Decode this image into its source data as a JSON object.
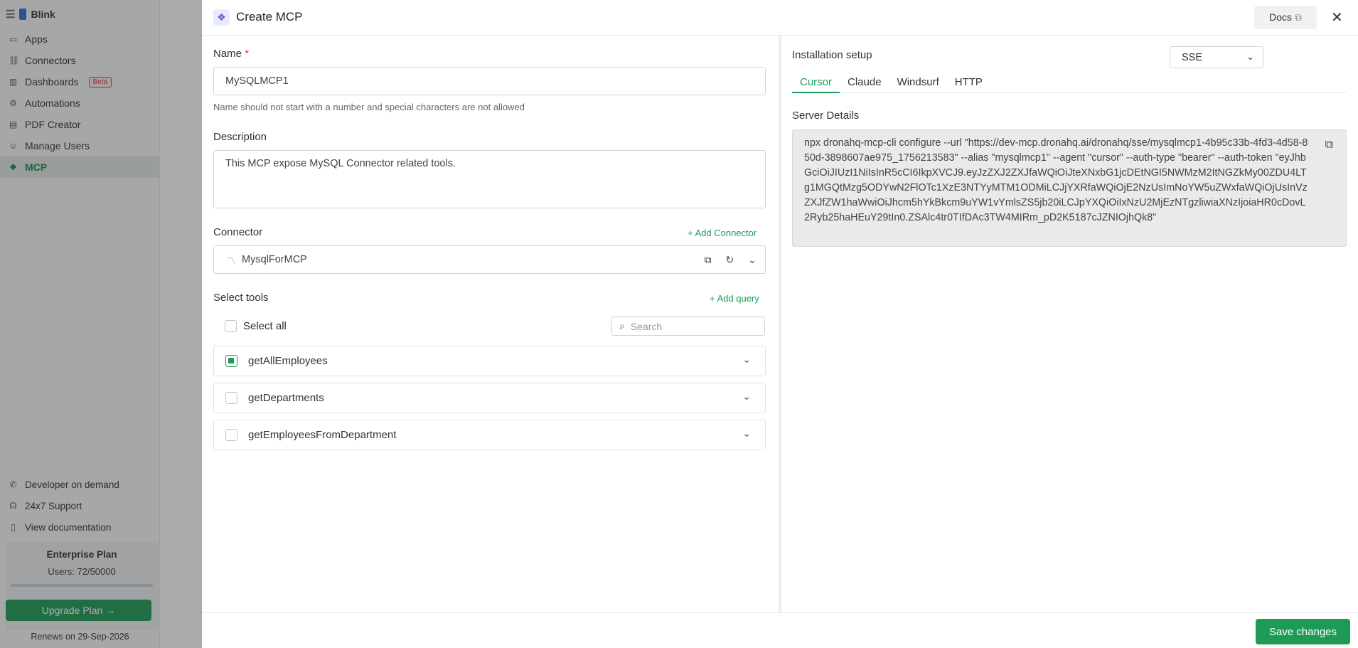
{
  "sidebar": {
    "brand": "Blink",
    "items": [
      {
        "label": "Apps",
        "icon": "apps-icon"
      },
      {
        "label": "Connectors",
        "icon": "link-icon"
      },
      {
        "label": "Dashboards",
        "icon": "chart-icon",
        "badge": "Beta"
      },
      {
        "label": "Automations",
        "icon": "automation-icon"
      },
      {
        "label": "PDF Creator",
        "icon": "pdf-icon"
      },
      {
        "label": "Manage Users",
        "icon": "user-icon"
      },
      {
        "label": "MCP",
        "icon": "mcp-icon",
        "active": true
      }
    ],
    "footer_links": [
      "Developer on demand",
      "24x7 Support",
      "View documentation"
    ],
    "plan": {
      "title": "Enterprise Plan",
      "users": "Users: 72/50000",
      "upgrade_label": "Upgrade Plan",
      "renews": "Renews on 29-Sep-2026"
    }
  },
  "modal": {
    "title": "Create MCP",
    "docs_label": "Docs",
    "name_label": "Name",
    "name_required": "*",
    "name_value": "MySQLMCP1",
    "name_hint": "Name should not start with a number and special characters are not allowed",
    "description_label": "Description",
    "description_value": "This MCP expose MySQL Connector related tools.",
    "connector_label": "Connector",
    "add_connector_label": "+ Add Connector",
    "connector_value": "MysqlForMCP",
    "select_tools_label": "Select tools",
    "add_query_label": "+ Add query",
    "select_all_label": "Select all",
    "search_placeholder": "Search",
    "tools": [
      {
        "name": "getAllEmployees",
        "checked": true
      },
      {
        "name": "getDepartments",
        "checked": false
      },
      {
        "name": "getEmployeesFromDepartment",
        "checked": false
      }
    ],
    "install_setup_label": "Installation setup",
    "transport_value": "SSE",
    "install_tabs": [
      "Cursor",
      "Claude",
      "Windsurf",
      "HTTP"
    ],
    "active_tab": "Cursor",
    "server_details_label": "Server Details",
    "server_command": "npx dronahq-mcp-cli configure --url \"https://dev-mcp.dronahq.ai/dronahq/sse/mysqlmcp1-4b95c33b-4fd3-4d58-850d-3898607ae975_1756213583\" --alias \"mysqlmcp1\" --agent \"cursor\" --auth-type \"bearer\" --auth-token \"eyJhbGciOiJIUzI1NiIsInR5cCI6IkpXVCJ9.eyJzZXJ2ZXJfaWQiOiJteXNxbG1jcDEtNGI5NWMzM2ItNGZkMy00ZDU4LTg1MGQtMzg5ODYwN2FlOTc1XzE3NTYyMTM1ODMiLCJjYXRfaWQiOjE2NzUsImNoYW5uZWxfaWQiOjUsInVzZXJfZW1haWwiOiJhcm5hYkBkcm9uYW1vYmlsZS5jb20iLCJpYXQiOiIxNzU2MjEzNTgzliwiaXNzIjoiaHR0cDovL2Ryb25haHEuY29tIn0.ZSAlc4tr0TIfDAc3TW4MIRm_pD2K5187cJZNIOjhQk8\"",
    "save_label": "Save changes"
  }
}
